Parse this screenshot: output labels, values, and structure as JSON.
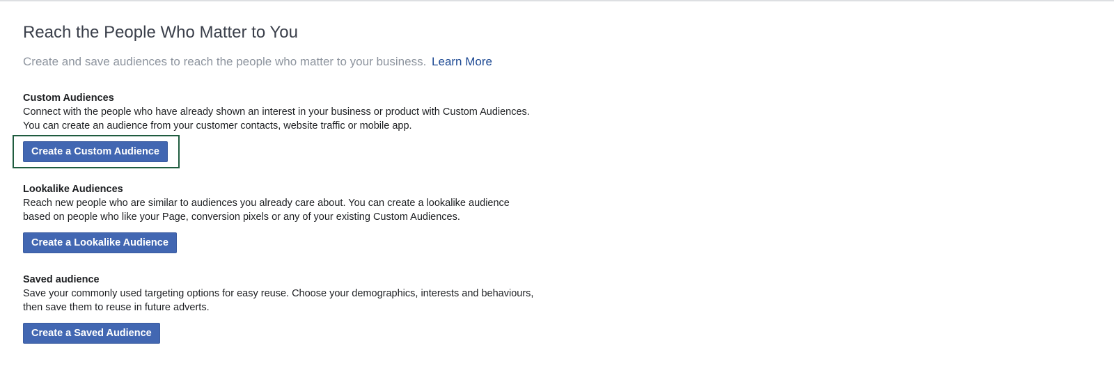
{
  "page": {
    "title": "Reach the People Who Matter to You",
    "subtitle": "Create and save audiences to reach the people who matter to your business.",
    "learn_more": "Learn More"
  },
  "sections": [
    {
      "title": "Custom Audiences",
      "description": "Connect with the people who have already shown an interest in your business or product with Custom Audiences. You can create an audience from your customer contacts, website traffic or mobile app.",
      "button_label": "Create a Custom Audience",
      "highlighted": true
    },
    {
      "title": "Lookalike Audiences",
      "description": "Reach new people who are similar to audiences you already care about. You can create a lookalike audience based on people who like your Page, conversion pixels or any of your existing Custom Audiences.",
      "button_label": "Create a Lookalike Audience",
      "highlighted": false
    },
    {
      "title": "Saved audience",
      "description": "Save your commonly used targeting options for easy reuse. Choose your demographics, interests and behaviours, then save them to reuse in future adverts.",
      "button_label": "Create a Saved Audience",
      "highlighted": false
    }
  ],
  "colors": {
    "button_bg": "#4267b2",
    "link": "#1d4993",
    "highlight_border": "#1f5c3f"
  }
}
